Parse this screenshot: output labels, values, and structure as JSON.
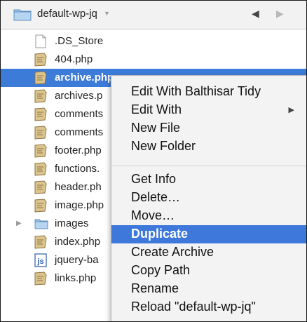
{
  "header": {
    "folder_name": "default-wp-jq",
    "dropdown_glyph": "▼",
    "back_glyph": "◀",
    "forward_glyph": "▶"
  },
  "files": [
    {
      "name": ".DS_Store",
      "icon": "blank-file-icon"
    },
    {
      "name": "404.php",
      "icon": "php-file-icon"
    },
    {
      "name": "archive.php",
      "icon": "php-file-icon",
      "selected": true
    },
    {
      "name": "archives.p",
      "icon": "php-file-icon"
    },
    {
      "name": "comments",
      "icon": "php-file-icon"
    },
    {
      "name": "comments",
      "icon": "php-file-icon"
    },
    {
      "name": "footer.php",
      "icon": "php-file-icon"
    },
    {
      "name": "functions.",
      "icon": "php-file-icon"
    },
    {
      "name": "header.ph",
      "icon": "php-file-icon"
    },
    {
      "name": "image.php",
      "icon": "php-file-icon"
    },
    {
      "name": "images",
      "icon": "folder-icon",
      "folder": true
    },
    {
      "name": "index.php",
      "icon": "php-file-icon"
    },
    {
      "name": "jquery-ba",
      "icon": "js-file-icon",
      "badge": "js"
    },
    {
      "name": "links.php",
      "icon": "php-file-icon"
    }
  ],
  "context_menu": {
    "items": [
      {
        "label": "Edit With Balthisar Tidy"
      },
      {
        "label": "Edit With",
        "submenu": true
      },
      {
        "label": "New File"
      },
      {
        "label": "New Folder"
      },
      {
        "label": "Get Info"
      },
      {
        "label": "Delete…"
      },
      {
        "label": "Move…"
      },
      {
        "label": "Duplicate",
        "highlighted": true
      },
      {
        "label": "Create Archive"
      },
      {
        "label": "Copy Path"
      },
      {
        "label": "Rename"
      },
      {
        "label": "Reload \"default-wp-jq\""
      }
    ],
    "submenu_glyph": "▶"
  },
  "colors": {
    "selection_blue": "#3d7bd8",
    "menu_highlight": "#3d78da",
    "menu_background": "#f3f3f3",
    "folder_blue": "#9cc3e8"
  }
}
